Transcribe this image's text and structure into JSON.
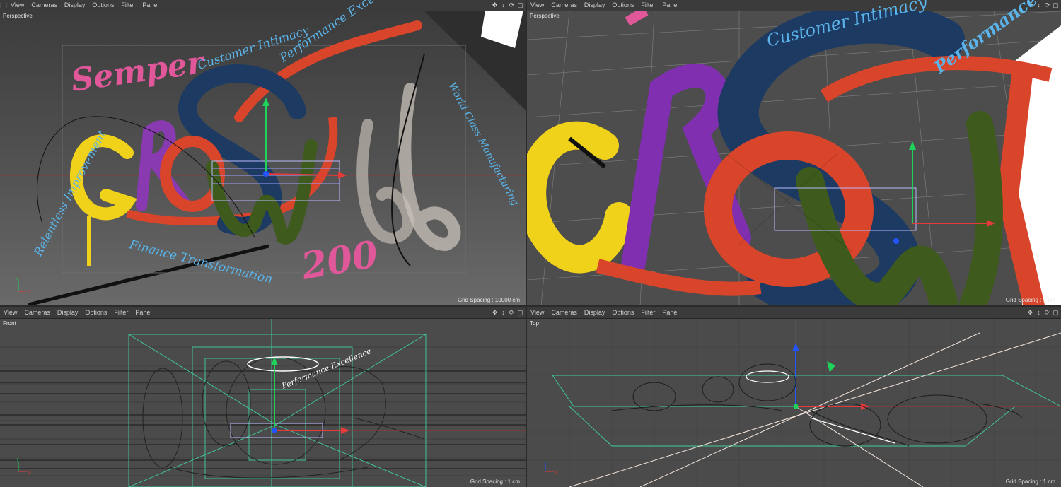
{
  "menu": [
    "View",
    "Cameras",
    "Display",
    "Options",
    "Filter",
    "Panel"
  ],
  "viewports": [
    {
      "name": "Perspective",
      "grid_spacing": "Grid Spacing : 10000 cm"
    },
    {
      "name": "Perspective",
      "grid_spacing": "Grid Spacing : 1 cm"
    },
    {
      "name": "Front",
      "grid_spacing": "Grid Spacing : 1 cm"
    },
    {
      "name": "Top",
      "grid_spacing": "Grid Spacing : 1 cm"
    }
  ],
  "scene_text": {
    "semper": "Semper",
    "customer": "Customer Intimacy",
    "performance": "Performance Excellence",
    "world_class": "World Class Manufacturing",
    "relentless": "Relentless Improvement",
    "finance": "Finance Transformation",
    "number": "200"
  },
  "axis": {
    "x": "X",
    "y": "Y"
  },
  "icons": [
    "move-view-icon",
    "move-depth-icon",
    "rotate-view-icon",
    "maximize-view-icon"
  ],
  "colors": {
    "red": "#d9452b",
    "blue": "#1d3a63",
    "yellow": "#f0d21a",
    "purple": "#8a3ab0",
    "green": "#3e5a1c",
    "pink": "#e0589a",
    "cyan": "#5ab4ea",
    "axis_green": "#1fd25a",
    "wire_green": "#3fcf9a"
  }
}
